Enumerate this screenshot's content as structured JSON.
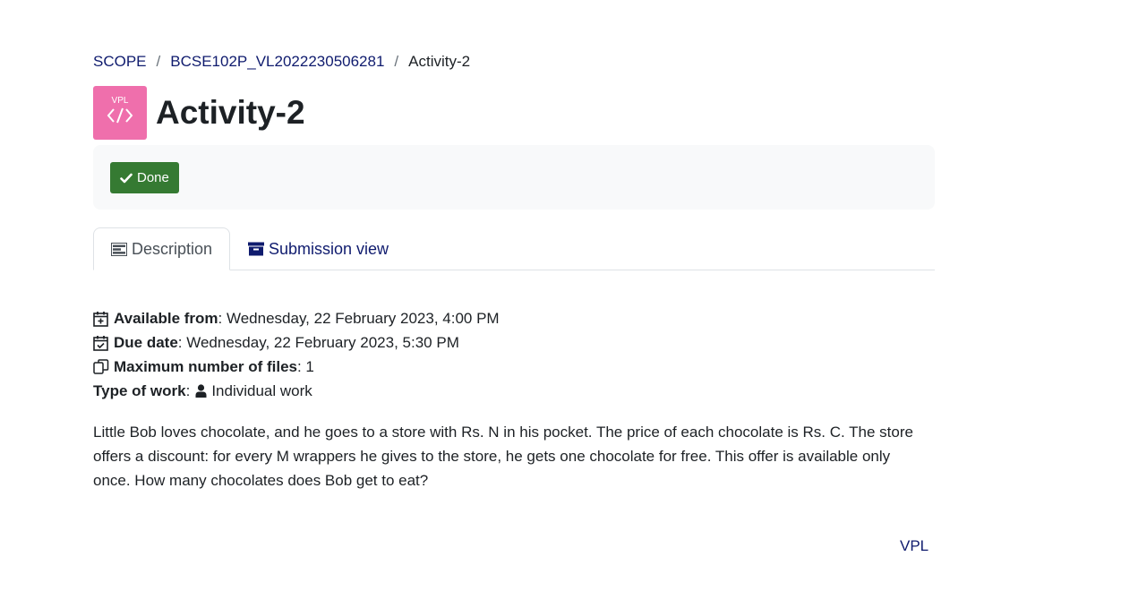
{
  "breadcrumb": {
    "items": [
      "SCOPE",
      "BCSE102P_VL2022230506281",
      "Activity-2"
    ],
    "separator": "/"
  },
  "activity": {
    "icon_label": "VPL",
    "title": "Activity-2"
  },
  "completion": {
    "done_label": "Done"
  },
  "tabs": [
    {
      "label": "Description",
      "icon": "list-icon",
      "active": true
    },
    {
      "label": "Submission view",
      "icon": "archive-icon",
      "active": false
    }
  ],
  "details": {
    "available_from_label": "Available from",
    "available_from_value": ": Wednesday, 22 February 2023, 4:00 PM",
    "due_date_label": "Due date",
    "due_date_value": ": Wednesday, 22 February 2023, 5:30 PM",
    "max_files_label": "Maximum number of files",
    "max_files_value": ": 1",
    "work_type_label": "Type of work",
    "work_type_sep": ":",
    "work_type_value": "Individual work"
  },
  "description": "Little Bob loves chocolate, and he goes to a store with Rs. N in his pocket. The price of each chocolate is Rs. C. The store offers a discount: for every M wrappers he gives to the store, he gets one chocolate for free. This offer is available only once. How many chocolates does Bob get to eat?",
  "footer": {
    "link_label": "VPL"
  },
  "colors": {
    "link": "#0f1b6e",
    "done_button": "#357a32",
    "vpl_icon_bg": "#ef6fac",
    "panel_bg": "#f8f9fa"
  }
}
